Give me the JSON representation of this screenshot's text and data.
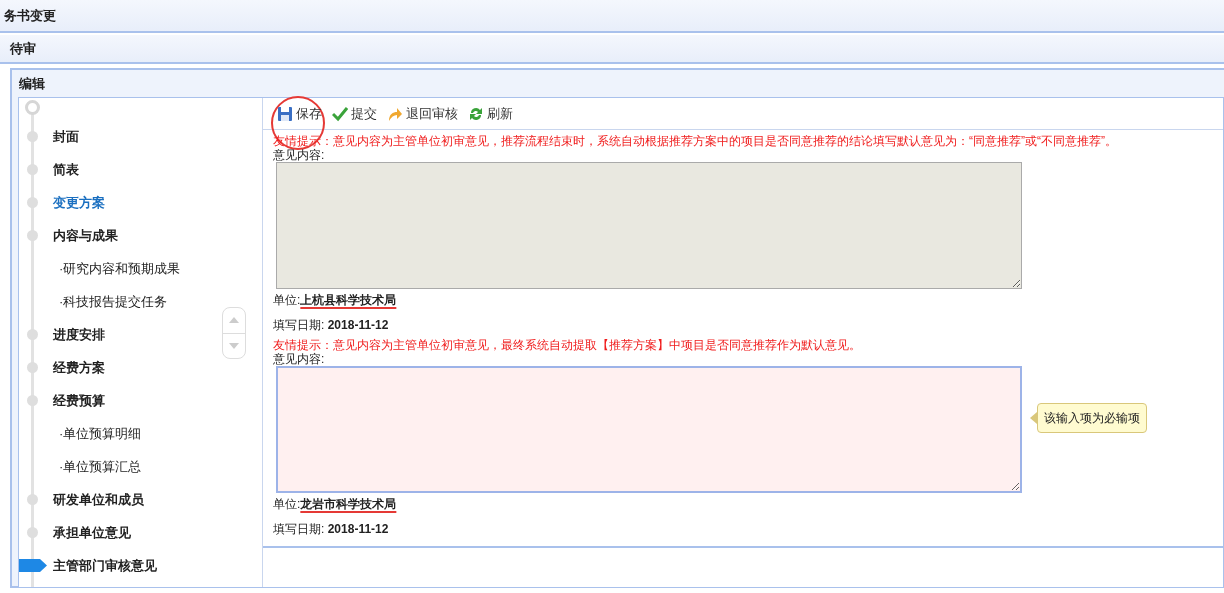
{
  "window": {
    "title": "务书变更"
  },
  "panel": {
    "title": "待审"
  },
  "editor": {
    "title": "编辑"
  },
  "sidebar": {
    "items": [
      {
        "label": "封面",
        "kind": "section",
        "selected": false,
        "hovered": false
      },
      {
        "label": "简表",
        "kind": "section",
        "selected": false,
        "hovered": false
      },
      {
        "label": "变更方案",
        "kind": "section",
        "selected": false,
        "hovered": true
      },
      {
        "label": "内容与成果",
        "kind": "section",
        "selected": false,
        "hovered": false
      },
      {
        "label": "·研究内容和预期成果",
        "kind": "sub",
        "selected": false,
        "hovered": false
      },
      {
        "label": "·科技报告提交任务",
        "kind": "sub",
        "selected": false,
        "hovered": false
      },
      {
        "label": "进度安排",
        "kind": "section",
        "selected": false,
        "hovered": false
      },
      {
        "label": "经费方案",
        "kind": "section",
        "selected": false,
        "hovered": false
      },
      {
        "label": "经费预算",
        "kind": "section",
        "selected": false,
        "hovered": false
      },
      {
        "label": "·单位预算明细",
        "kind": "sub",
        "selected": false,
        "hovered": false
      },
      {
        "label": "·单位预算汇总",
        "kind": "sub",
        "selected": false,
        "hovered": false
      },
      {
        "label": "研发单位和成员",
        "kind": "section",
        "selected": false,
        "hovered": false
      },
      {
        "label": "承担单位意见",
        "kind": "section",
        "selected": false,
        "hovered": false
      },
      {
        "label": "主管部门审核意见",
        "kind": "section",
        "selected": true,
        "hovered": false
      }
    ]
  },
  "toolbar": [
    {
      "label": "保存",
      "kind": "save",
      "circled": true
    },
    {
      "label": "提交",
      "kind": "submit",
      "circled": false
    },
    {
      "label": "退回审核",
      "kind": "return",
      "circled": false
    },
    {
      "label": "刷新",
      "kind": "refresh",
      "circled": false
    }
  ],
  "opinions": [
    {
      "tip": "友情提示：意见内容为主管单位初审意见，推荐流程结束时，系统自动根据推荐方案中的项目是否同意推荐的结论填写默认意见为：“同意推荐”或“不同意推荐”。",
      "content_label": "意见内容:",
      "disabled": true,
      "focused": false,
      "unit_label": "单位:",
      "unit": "上杭县科学技术局",
      "struck": true,
      "date_label": "填写日期:",
      "date": "2018-11-12"
    },
    {
      "tip": "友情提示：意见内容为主管单位初审意见，最终系统自动提取【推荐方案】中项目是否同意推荐作为默认意见。",
      "content_label": "意见内容:",
      "disabled": false,
      "focused": true,
      "error": "该输入项为必输项",
      "unit_label": "单位:",
      "unit": "龙岩市科学技术局",
      "struck": true,
      "date_label": "填写日期:",
      "date": "2018-11-12"
    }
  ]
}
